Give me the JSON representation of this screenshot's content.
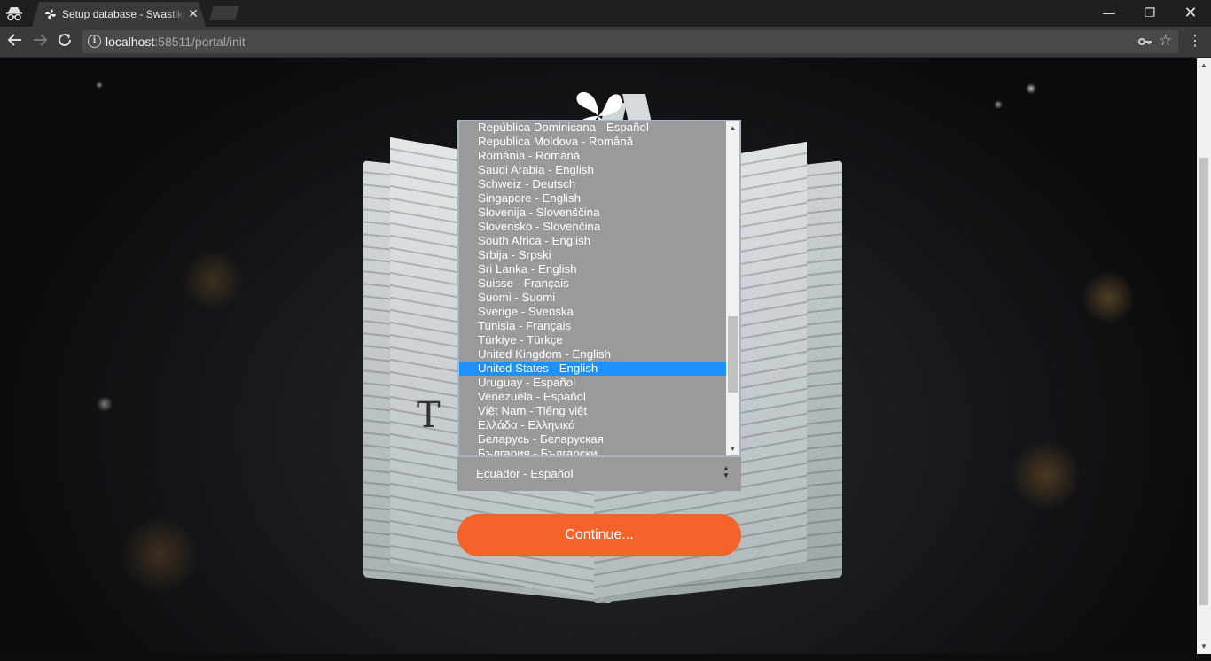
{
  "browser": {
    "tab_title": "Setup database - Swastika",
    "tab_close": "✕",
    "url_host": "localhost",
    "url_path": ":58511/portal/init"
  },
  "icons": {
    "incognito": "incognito-icon",
    "back": "arrow-left-icon",
    "forward": "arrow-right-icon",
    "reload": "reload-icon",
    "info": "info-icon",
    "key": "key-icon",
    "star": "star-icon",
    "menu": "kebab-menu-icon",
    "logo": "swirl-logo-icon"
  },
  "listbox": {
    "items": [
      "República Dominicana - Español",
      "Republica Moldova - Română",
      "România - Română",
      "Saudi Arabia - English",
      "Schweiz - Deutsch",
      "Singapore - English",
      "Slovenija - Slovenščina",
      "Slovensko - Slovenčina",
      "South Africa - English",
      "Srbija - Srpski",
      "Sri Lanka - English",
      "Suisse - Français",
      "Suomi - Suomi",
      "Sverige - Svenska",
      "Tunisia - Français",
      "Türkiye - Türkçe",
      "United Kingdom - English",
      "United States - English",
      "Uruguay - Español",
      "Venezuela - Español",
      "Việt Nam - Tiếng việt",
      "Ελλάδα - Ελληνικά",
      "Беларусь - Беларуская",
      "България - Български"
    ],
    "selected_item": "United States - English"
  },
  "culture_select": {
    "value": "Ecuador - Español"
  },
  "continue_label": "Continue...",
  "colors": {
    "accent": "#f7622b",
    "selection": "#1e90ff",
    "field_bg": "#9a9a9a"
  }
}
